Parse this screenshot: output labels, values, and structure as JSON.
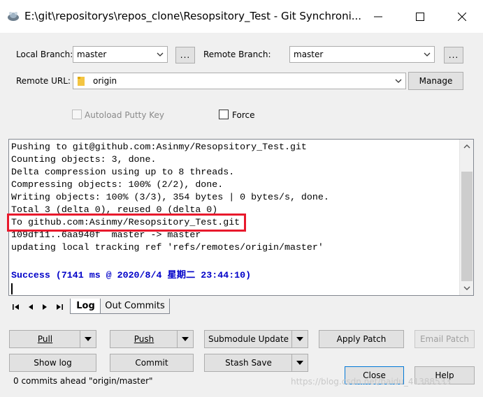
{
  "window": {
    "title": "E:\\git\\repositorys\\repos_clone\\Resopsitory_Test - Git Synchroni...",
    "icons": [
      "app-icon",
      "minimize-icon",
      "maximize-icon",
      "close-icon"
    ]
  },
  "branch": {
    "local_label": "Local Branch:",
    "local_value": "master",
    "remote_label": "Remote Branch:",
    "remote_value": "master",
    "browse_label": "..."
  },
  "remote": {
    "url_label": "Remote URL:",
    "url_value": "origin",
    "manage_label": "Manage"
  },
  "options": {
    "autoload_label": "Autoload Putty Key",
    "autoload_checked": false,
    "autoload_enabled": false,
    "force_label": "Force",
    "force_checked": false
  },
  "log": {
    "lines": [
      "Pushing to git@github.com:Asinmy/Resopsitory_Test.git",
      "Counting objects: 3, done.",
      "Delta compression using up to 8 threads.",
      "Compressing objects: 100% (2/2), done.",
      "Writing objects: 100% (3/3), 354 bytes | 0 bytes/s, done.",
      "Total 3 (delta 0), reused 0 (delta 0)",
      "To github.com:Asinmy/Resopsitory_Test.git",
      "109df11..6aa940f  master -> master",
      "updating local tracking ref 'refs/remotes/origin/master'"
    ],
    "success": "Success (7141 ms @ 2020/8/4 星期二 23:44:10)",
    "highlight_color": "#e8192c",
    "success_color": "#0000c8"
  },
  "tabs": [
    {
      "label": "Log",
      "active": true
    },
    {
      "label": "Out Commits",
      "active": false
    }
  ],
  "buttons": {
    "pull": "Pull",
    "push": "Push",
    "submodule_update": "Submodule Update",
    "apply_patch": "Apply Patch",
    "email_patch": "Email Patch",
    "show_log": "Show log",
    "commit": "Commit",
    "stash_save": "Stash Save",
    "close": "Close",
    "help": "Help"
  },
  "status": {
    "text": "0 commits ahead \"origin/master\""
  },
  "watermark": "https://blog.csdn.net/baidu_41388533"
}
